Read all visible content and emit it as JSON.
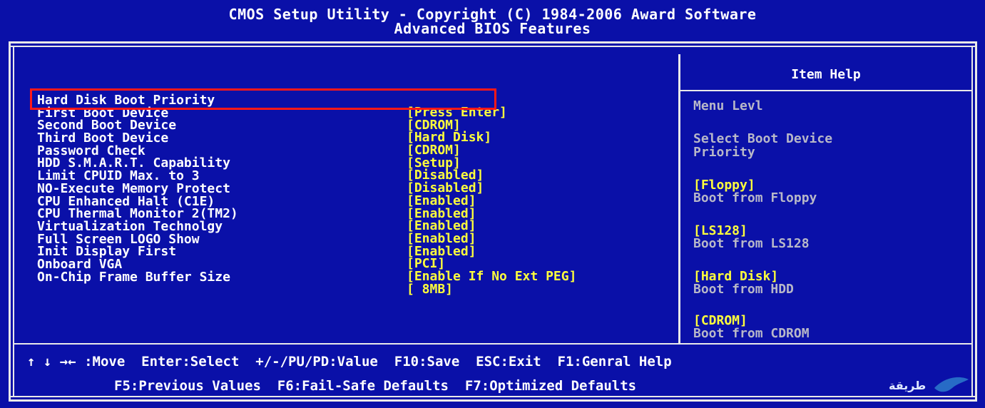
{
  "header": {
    "line1": "CMOS Setup Utility - Copyright  (C)  1984-2006 Award Software",
    "line2": "Advanced BIOS Features"
  },
  "settings": [
    {
      "label": "Hard Disk Boot Priority",
      "value": "[Press Enter]"
    },
    {
      "label": "First Boot Device",
      "value": "[CDROM]"
    },
    {
      "label": "Second Boot Device",
      "value": "[Hard Disk]"
    },
    {
      "label": "Third Boot Device",
      "value": "[CDROM]"
    },
    {
      "label": "Password Check",
      "value": "[Setup]"
    },
    {
      "label": "HDD S.M.A.R.T. Capability",
      "value": "[Disabled]"
    },
    {
      "label": "Limit CPUID Max. to 3",
      "value": "[Disabled]"
    },
    {
      "label": "NO-Execute Memory Protect",
      "value": "[Enabled]"
    },
    {
      "label": "CPU Enhanced Halt (C1E)",
      "value": "[Enabled]"
    },
    {
      "label": "CPU Thermal Monitor 2(TM2)",
      "value": "[Enabled]"
    },
    {
      "label": "Virtualization Technolgy",
      "value": "[Enabled]"
    },
    {
      "label": "Full Screen LOGO Show",
      "value": "[Enabled]"
    },
    {
      "label": "Init Display First",
      "value": "[PCI]"
    },
    {
      "label": "Onboard VGA",
      "value": "[Enable If No Ext PEG]"
    },
    {
      "label": "On-Chip Frame Buffer Size",
      "value": "[ 8MB]"
    }
  ],
  "help": {
    "title": "Item Help",
    "menu_level": "Menu Levl",
    "description_line1": "Select Boot Device",
    "description_line2": "Priority",
    "options": [
      {
        "key": "[Floppy]",
        "desc": "Boot from Floppy"
      },
      {
        "key": "[LS128]",
        "desc": "Boot from LS128"
      },
      {
        "key": "[Hard Disk]",
        "desc": "Boot from HDD"
      },
      {
        "key": "[CDROM]",
        "desc": "Boot from CDROM"
      }
    ]
  },
  "footer": {
    "line1": "↑ ↓ →← :Move  Enter:Select  +/-/PU/PD:Value  F10:Save  ESC:Exit  F1:Genral Help",
    "line2": "F5:Previous Values  F6:Fail-Safe Defaults  F7:Optimized Defaults"
  },
  "watermark": {
    "text": "طريقة"
  },
  "colors": {
    "background": "#0a10a8",
    "text": "#ffffff",
    "value": "#ffff3c",
    "help_gray": "#b8b8c8",
    "highlight_box": "#ff1818"
  }
}
